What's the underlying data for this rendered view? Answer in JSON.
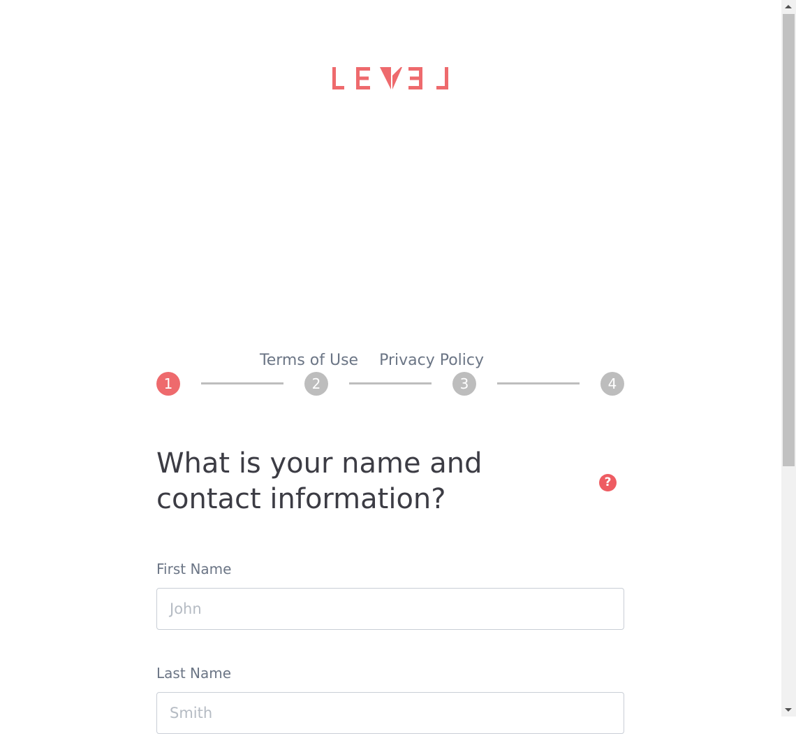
{
  "logo": {
    "text": "LEVEL",
    "color": "#ee6a6d"
  },
  "links": {
    "terms": "Terms of Use",
    "privacy": "Privacy Policy"
  },
  "stepper": {
    "steps": [
      "1",
      "2",
      "3",
      "4"
    ],
    "current": 1
  },
  "form": {
    "heading": "What is your name and contact information?",
    "help_icon": "?",
    "first_name": {
      "label": "First Name",
      "value": "",
      "placeholder": "John"
    },
    "last_name": {
      "label": "Last Name",
      "value": "",
      "placeholder": "Smith"
    }
  }
}
